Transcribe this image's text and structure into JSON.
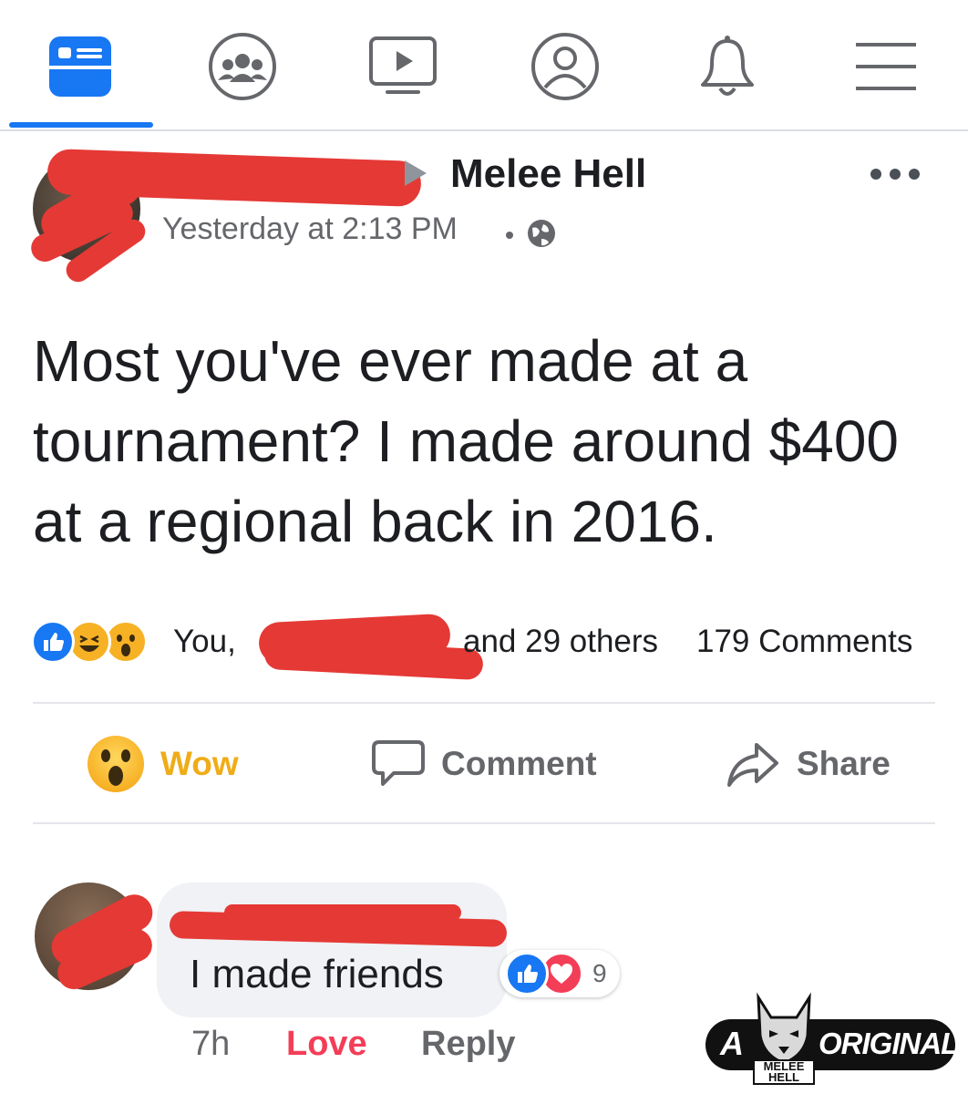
{
  "nav": {
    "items": [
      "news-feed",
      "groups",
      "watch",
      "profile",
      "notifications",
      "menu"
    ],
    "active": "news-feed",
    "accent_color": "#1877f2"
  },
  "post": {
    "group_name": "Melee Hell",
    "timestamp": "Yesterday at 2:13 PM",
    "privacy_icon": "globe-icon",
    "text": "Most you've ever made at a tournament? I made around $400 at a regional back in 2016.",
    "reactions": {
      "types": [
        "like",
        "haha",
        "wow"
      ],
      "prefix": "You, ",
      "others": "and 29 others",
      "comments_count": "179 Comments"
    },
    "actions": {
      "wow_label": "Wow",
      "wow_color": "#f7b125",
      "comment_label": "Comment",
      "share_label": "Share"
    }
  },
  "comment": {
    "text": "I made friends",
    "reaction_types": [
      "like",
      "love"
    ],
    "reaction_count": "9",
    "time": "7h",
    "love_label": "Love",
    "love_color": "#f33e58",
    "reply_label": "Reply"
  },
  "badge": {
    "prefix": "A",
    "suffix": "ORIGINAL",
    "logo_text": "MELEE HELL"
  }
}
